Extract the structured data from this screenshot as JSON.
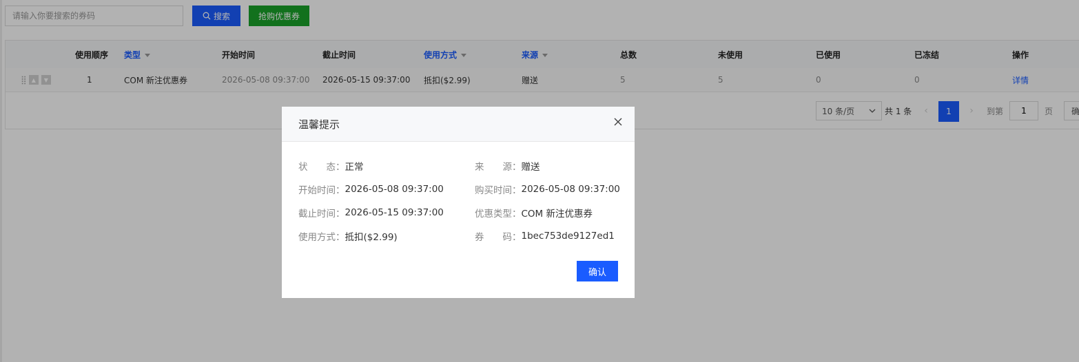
{
  "search": {
    "placeholder": "请输入你要搜索的券码",
    "search_button": "搜索",
    "grab_button": "抢购优惠券"
  },
  "table": {
    "headers": {
      "order": "使用顺序",
      "type": "类型",
      "start_time": "开始时间",
      "end_time": "截止时间",
      "usage": "使用方式",
      "source": "来源",
      "total": "总数",
      "unused": "未使用",
      "used": "已使用",
      "frozen": "已冻结",
      "action": "操作"
    },
    "rows": [
      {
        "order": "1",
        "type": "COM 新注优惠券",
        "start_time": "2026-05-08 09:37:00",
        "end_time": "2026-05-15 09:37:00",
        "usage": "抵扣($2.99)",
        "source": "赠送",
        "total": "5",
        "unused": "5",
        "used": "0",
        "frozen": "0",
        "action": "详情"
      }
    ]
  },
  "pagination": {
    "page_size": "10 条/页",
    "total": "共 1 条",
    "current_page": "1",
    "goto_label": "到第",
    "goto_value": "1",
    "page_label": "页",
    "confirm_partial": "确"
  },
  "dialog": {
    "title": "温馨提示",
    "fields": {
      "status_label": "状　　态：",
      "status_value": "正常",
      "source_label": "来　　源：",
      "source_value": "赠送",
      "start_label": "开始时间：",
      "start_value": "2026-05-08 09:37:00",
      "buy_label": "购买时间：",
      "buy_value": "2026-05-08 09:37:00",
      "end_label": "截止时间：",
      "end_value": "2026-05-15 09:37:00",
      "type_label": "优惠类型：",
      "type_value": "COM 新注优惠券",
      "usage_label": "使用方式：",
      "usage_value": "抵扣($2.99)",
      "code_label": "券　　码：",
      "code_value": "1bec753de9127ed1"
    },
    "ok_button": "确认"
  },
  "colors": {
    "primary": "#1a5cff",
    "success": "#1aa32a"
  }
}
